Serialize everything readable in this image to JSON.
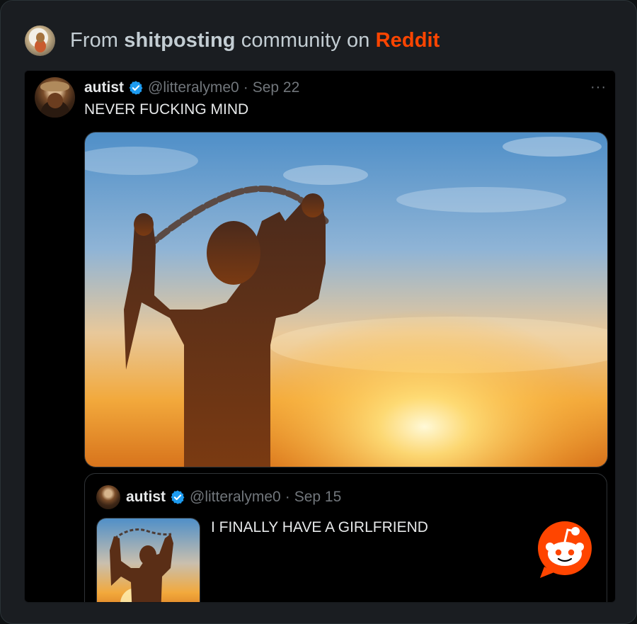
{
  "embed": {
    "prefix": "From ",
    "community": "shitposting",
    "middle": " community on ",
    "platform": "Reddit"
  },
  "tweet": {
    "name": "autist",
    "handle": "@litteralyme0",
    "separator": "·",
    "date": "Sep 22",
    "more_label": "···",
    "text": "NEVER FUCKING MIND"
  },
  "quoted_tweet": {
    "name": "autist",
    "handle": "@litteralyme0",
    "separator": "·",
    "date": "Sep 15",
    "text": "I FINALLY HAVE A GIRLFRIEND"
  },
  "colors": {
    "reddit_orange": "#ff4500",
    "verified_blue": "#1d9bf0",
    "background": "#000000"
  },
  "icons": {
    "verified": "verified-badge-icon",
    "more": "more-options-icon",
    "reddit": "reddit-logo-icon"
  }
}
